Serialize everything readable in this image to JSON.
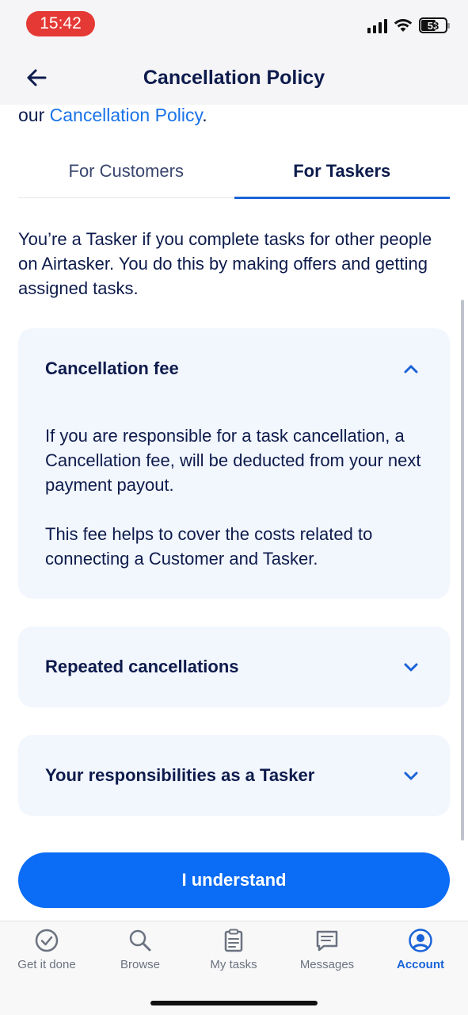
{
  "status_bar": {
    "time": "15:42",
    "battery": "53"
  },
  "header": {
    "title": "Cancellation Policy"
  },
  "intro": {
    "prefix": "our ",
    "link_text": "Cancellation Policy",
    "suffix": "."
  },
  "tabs": [
    {
      "label": "For Customers",
      "active": false
    },
    {
      "label": "For Taskers",
      "active": true
    }
  ],
  "description": "You’re a Tasker if you complete tasks for other people on Airtasker. You do this by making offers and getting assigned tasks.",
  "sections": [
    {
      "title": "Cancellation fee",
      "expanded": true,
      "paragraphs": [
        "If you are responsible for a task cancellation, a Cancellation fee, will be deducted from your next payment payout.",
        "This fee helps to cover the costs related to connecting a Customer and Tasker."
      ]
    },
    {
      "title": "Repeated cancellations",
      "expanded": false
    },
    {
      "title": "Your responsibilities as a Tasker",
      "expanded": false
    }
  ],
  "primary_button": {
    "label": "I understand"
  },
  "tab_bar": {
    "items": [
      {
        "label": "Get it done",
        "icon": "check-circle-icon",
        "active": false
      },
      {
        "label": "Browse",
        "icon": "search-icon",
        "active": false
      },
      {
        "label": "My tasks",
        "icon": "clipboard-icon",
        "active": false
      },
      {
        "label": "Messages",
        "icon": "message-icon",
        "active": false
      },
      {
        "label": "Account",
        "icon": "account-icon",
        "active": true
      }
    ]
  },
  "colors": {
    "accent": "#0b6cf5",
    "text": "#0d1b4c",
    "card_bg": "#f2f6fd",
    "time_pill": "#e53935"
  }
}
